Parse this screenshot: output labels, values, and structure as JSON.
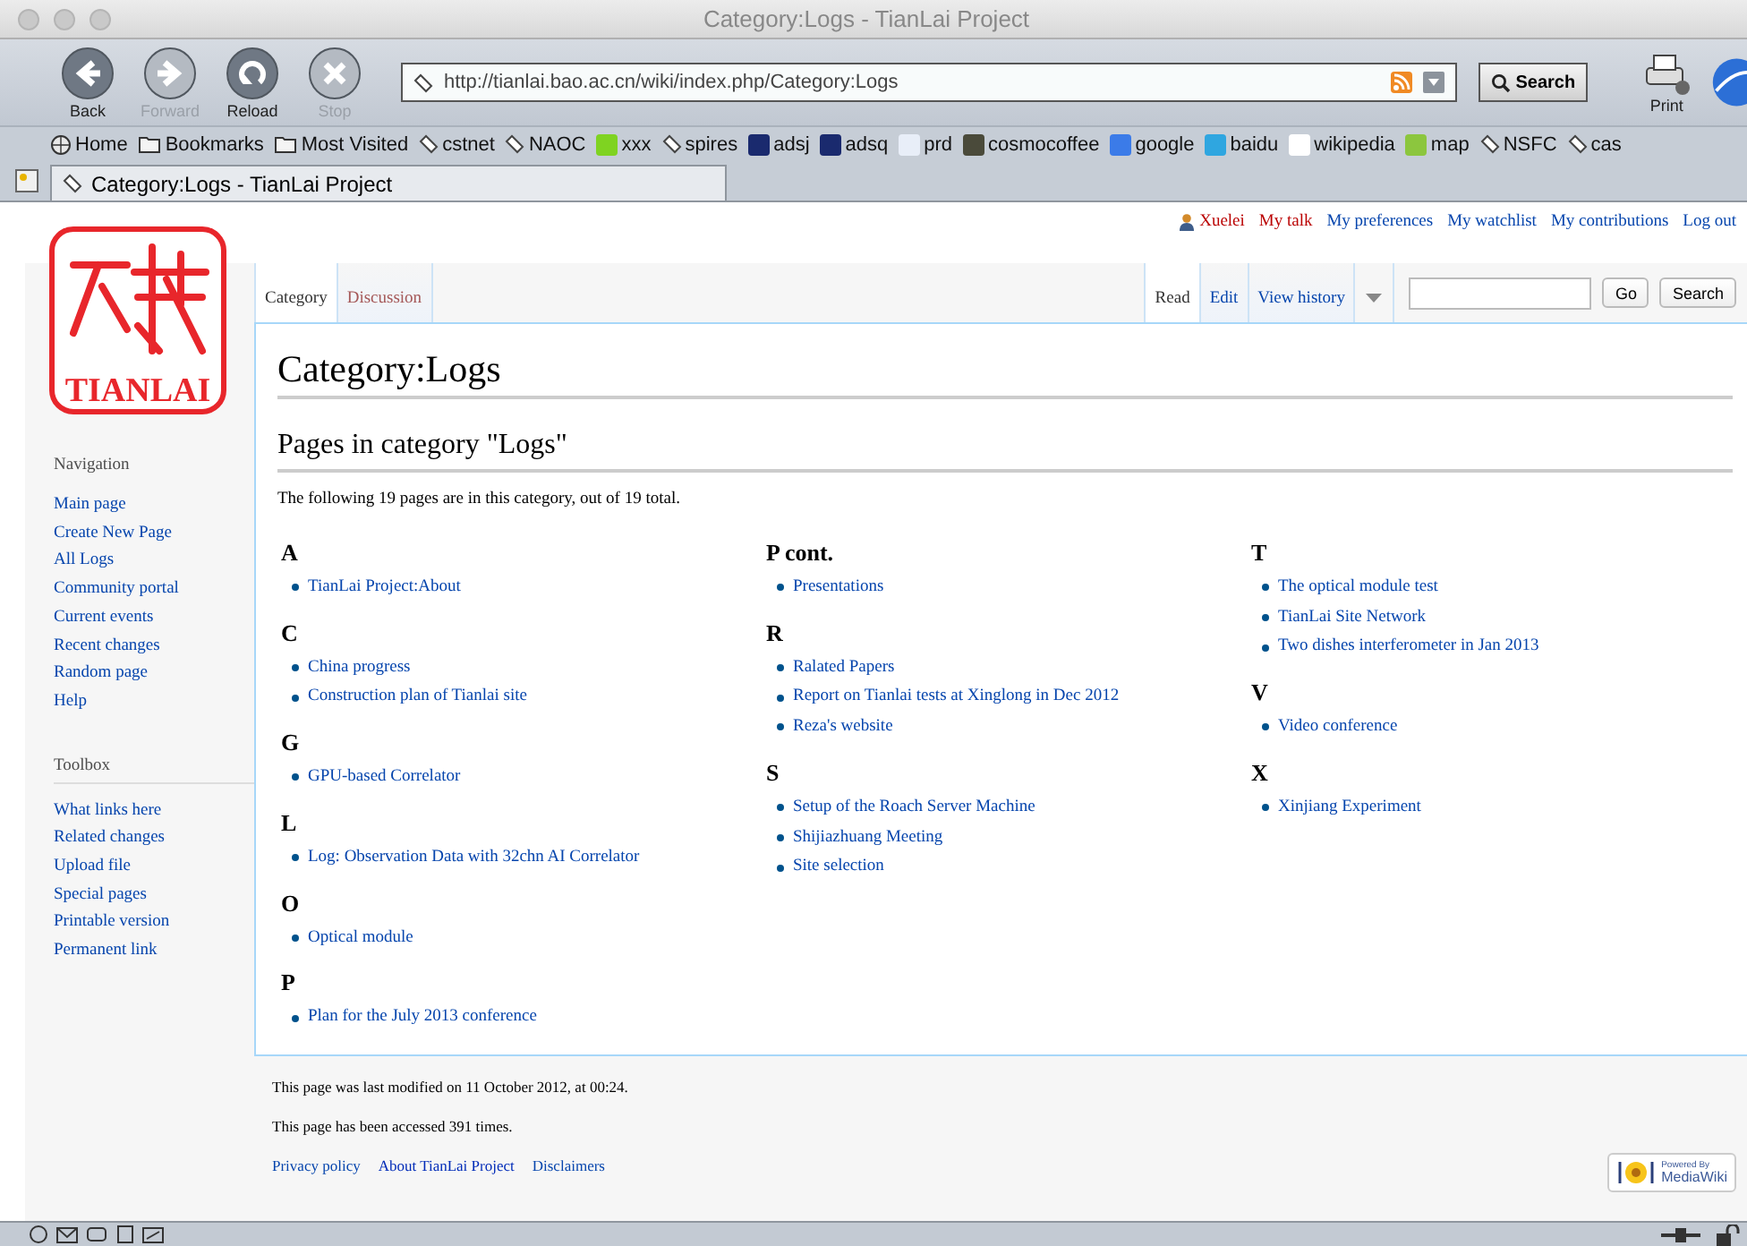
{
  "window": {
    "title": "Category:Logs - TianLai Project"
  },
  "toolbar": {
    "nav_buttons": [
      {
        "label": "Back",
        "kind": "back",
        "disabled": false
      },
      {
        "label": "Forward",
        "kind": "forward",
        "disabled": true
      },
      {
        "label": "Reload",
        "kind": "reload",
        "disabled": false
      },
      {
        "label": "Stop",
        "kind": "stop",
        "disabled": true
      }
    ],
    "url": "http://tianlai.bao.ac.cn/wiki/index.php/Category:Logs",
    "search_button": "Search",
    "print_button": "Print"
  },
  "bookmarks": [
    {
      "label": "Home",
      "kind": "home"
    },
    {
      "label": "Bookmarks",
      "kind": "folder"
    },
    {
      "label": "Most Visited",
      "kind": "folder"
    },
    {
      "label": "cstnet",
      "kind": "tag"
    },
    {
      "label": "NAOC",
      "kind": "tag"
    },
    {
      "label": "xxx",
      "kind": "favicon",
      "color": "#7fd321"
    },
    {
      "label": "spires",
      "kind": "tag"
    },
    {
      "label": "adsj",
      "kind": "favicon",
      "color": "#1a2a6e"
    },
    {
      "label": "adsq",
      "kind": "favicon",
      "color": "#1a2a6e"
    },
    {
      "label": "prd",
      "kind": "favicon",
      "color": "#e8eef8"
    },
    {
      "label": "cosmocoffee",
      "kind": "favicon",
      "color": "#4a4a3a"
    },
    {
      "label": "google",
      "kind": "favicon",
      "color": "#3b7be8"
    },
    {
      "label": "baidu",
      "kind": "favicon",
      "color": "#2fa6e0"
    },
    {
      "label": "wikipedia",
      "kind": "favicon",
      "color": "#ffffff"
    },
    {
      "label": "map",
      "kind": "favicon",
      "color": "#8cc63e"
    },
    {
      "label": "NSFC",
      "kind": "tag"
    },
    {
      "label": "cas",
      "kind": "tag"
    }
  ],
  "tabs": [
    {
      "label": "Category:Logs - TianLai Project",
      "selected": true
    }
  ],
  "personal_links": [
    {
      "label": "Xuelei",
      "new": true,
      "kind": "user"
    },
    {
      "label": "My talk",
      "new": true
    },
    {
      "label": "My preferences",
      "new": false
    },
    {
      "label": "My watchlist",
      "new": false
    },
    {
      "label": "My contributions",
      "new": false
    },
    {
      "label": "Log out",
      "new": false
    }
  ],
  "logo": {
    "text": "TIANLAI"
  },
  "sidebar": [
    {
      "title": "Navigation",
      "items": [
        "Main page",
        "Create New Page",
        "All Logs",
        "Community portal",
        "Current events",
        "Recent changes",
        "Random page",
        "Help"
      ]
    },
    {
      "title": "Toolbox",
      "items": [
        "What links here",
        "Related changes",
        "Upload file",
        "Special pages",
        "Printable version",
        "Permanent link"
      ]
    }
  ],
  "page_tabs": [
    {
      "label": "Category",
      "selected": true,
      "new": false
    },
    {
      "label": "Discussion",
      "selected": false,
      "new": true
    }
  ],
  "view_tabs": [
    {
      "label": "Read",
      "selected": true
    },
    {
      "label": "Edit",
      "selected": false
    },
    {
      "label": "View history",
      "selected": false
    }
  ],
  "search": {
    "go_button": "Go",
    "search_button": "Search"
  },
  "content": {
    "title": "Category:Logs",
    "subheading": "Pages in category \"Logs\"",
    "summary": "The following 19 pages are in this category, out of 19 total.",
    "columns": [
      [
        {
          "letter": "A",
          "items": [
            "TianLai Project:About"
          ]
        },
        {
          "letter": "C",
          "items": [
            "China progress",
            "Construction plan of Tianlai site"
          ]
        },
        {
          "letter": "G",
          "items": [
            "GPU-based Correlator"
          ]
        },
        {
          "letter": "L",
          "items": [
            "Log: Observation Data with 32chn AI Correlator"
          ]
        },
        {
          "letter": "O",
          "items": [
            "Optical module"
          ]
        },
        {
          "letter": "P",
          "items": [
            "Plan for the July 2013 conference"
          ]
        }
      ],
      [
        {
          "letter": "P cont.",
          "items": [
            "Presentations"
          ]
        },
        {
          "letter": "R",
          "items": [
            "Ralated Papers",
            "Report on Tianlai tests at Xinglong in Dec 2012",
            "Reza's website"
          ]
        },
        {
          "letter": "S",
          "items": [
            "Setup of the Roach Server Machine",
            "Shijiazhuang Meeting",
            "Site selection"
          ]
        }
      ],
      [
        {
          "letter": "T",
          "items": [
            "The optical module test",
            "TianLai Site Network",
            "Two dishes interferometer in Jan 2013"
          ]
        },
        {
          "letter": "V",
          "items": [
            "Video conference"
          ]
        },
        {
          "letter": "X",
          "items": [
            "Xinjiang Experiment"
          ]
        }
      ]
    ]
  },
  "footer": {
    "lines": [
      "This page was last modified on 11 October 2012, at 00:24.",
      "This page has been accessed 391 times."
    ],
    "links": [
      "Privacy policy",
      "About TianLai Project",
      "Disclaimers"
    ],
    "powered_by": {
      "top": "Powered By",
      "bottom": "MediaWiki"
    }
  }
}
